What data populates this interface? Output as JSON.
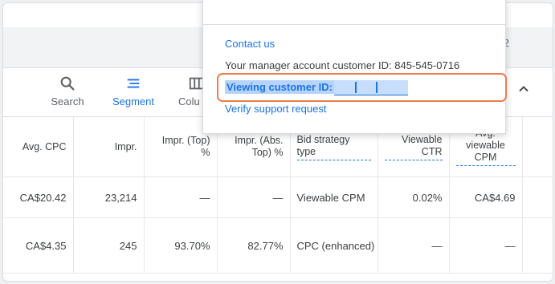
{
  "header": {
    "page_number": "2"
  },
  "toolbar": {
    "search_label": "Search",
    "segment_label": "Segment",
    "columns_label": "Colu"
  },
  "columns": {
    "avg_cpc": "Avg. CPC",
    "impr": "Impr.",
    "impr_top": "Impr. (Top) %",
    "impr_abs_top": "Impr. (Abs. Top) %",
    "bid_strategy": "Bid strategy type",
    "viewable_ctr": "Viewable CTR",
    "avg_viewable_cpm": "Avg. viewable CPM"
  },
  "rows": [
    {
      "avg_cpc": "CA$20.42",
      "impr": "23,214",
      "impr_top": "—",
      "impr_abs_top": "—",
      "bid_strategy": "Viewable CPM",
      "viewable_ctr": "0.02%",
      "avg_viewable_cpm": "CA$4.69"
    },
    {
      "avg_cpc": "CA$4.35",
      "impr": "245",
      "impr_top": "93.70%",
      "impr_abs_top": "82.77%",
      "bid_strategy": "CPC (enhanced)",
      "viewable_ctr": "—",
      "avg_viewable_cpm": "—"
    }
  ],
  "popup": {
    "contact_us": "Contact us",
    "manager_id": "Your manager account customer ID: 845-545-0716",
    "viewing_label": "Viewing customer ID:",
    "verify_support": "Verify support request"
  },
  "colors": {
    "accent": "#1a73e8",
    "highlight": "#ee7d4b",
    "selection": "#b6d4fb"
  }
}
